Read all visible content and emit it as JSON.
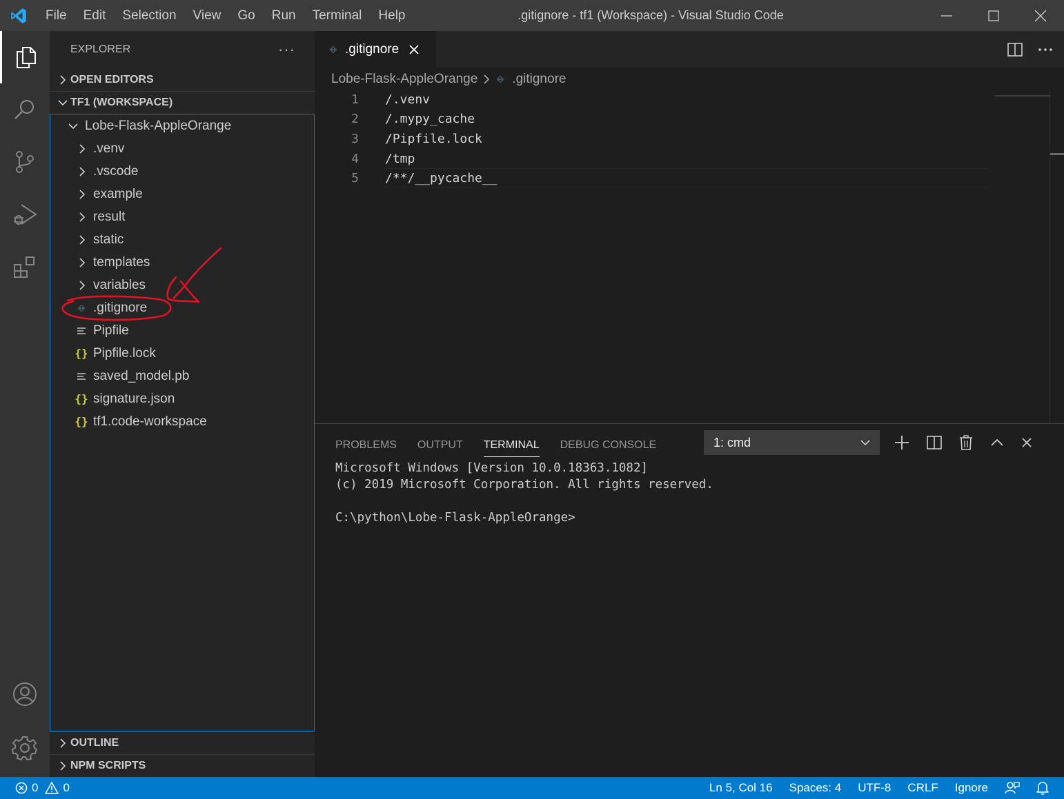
{
  "window": {
    "title": ".gitignore - tf1 (Workspace) - Visual Studio Code",
    "menu": [
      "File",
      "Edit",
      "Selection",
      "View",
      "Go",
      "Run",
      "Terminal",
      "Help"
    ]
  },
  "colors": {
    "titlebar": "#3c3c3c",
    "activitybar": "#333333",
    "sidebar": "#252526",
    "editor": "#1e1e1e",
    "statusbar": "#007acc",
    "focus_border": "#007fd4",
    "annotation": "#e81123",
    "json_icon": "#cbcb41"
  },
  "explorer": {
    "title": "EXPLORER",
    "more_label": "···",
    "open_editors": "OPEN EDITORS",
    "workspace": "TF1 (WORKSPACE)",
    "root_folder": "Lobe-Flask-AppleOrange",
    "folders": [
      ".venv",
      ".vscode",
      "example",
      "result",
      "static",
      "templates",
      "variables"
    ],
    "files": [
      {
        "name": ".gitignore",
        "icon": "git-icon"
      },
      {
        "name": "Pipfile",
        "icon": "lines-icon"
      },
      {
        "name": "Pipfile.lock",
        "icon": "json-icon"
      },
      {
        "name": "saved_model.pb",
        "icon": "lines-icon"
      },
      {
        "name": "signature.json",
        "icon": "json-icon"
      },
      {
        "name": "tf1.code-workspace",
        "icon": "json-icon"
      }
    ],
    "outline": "OUTLINE",
    "npm_scripts": "NPM SCRIPTS"
  },
  "editor": {
    "tab_label": ".gitignore",
    "breadcrumb": [
      "Lobe-Flask-AppleOrange",
      ".gitignore"
    ],
    "lines": [
      {
        "num": "1",
        "text": "/.venv"
      },
      {
        "num": "2",
        "text": "/.mypy_cache"
      },
      {
        "num": "3",
        "text": "/Pipfile.lock"
      },
      {
        "num": "4",
        "text": "/tmp"
      },
      {
        "num": "5",
        "text": "/**/__pycache__"
      }
    ]
  },
  "panel": {
    "tabs": [
      "PROBLEMS",
      "OUTPUT",
      "TERMINAL",
      "DEBUG CONSOLE"
    ],
    "active_tab": "TERMINAL",
    "terminal_select": "1: cmd",
    "terminal_lines": [
      "Microsoft Windows [Version 10.0.18363.1082]",
      "(c) 2019 Microsoft Corporation. All rights reserved.",
      "",
      "C:\\python\\Lobe-Flask-AppleOrange>"
    ]
  },
  "status": {
    "errors": "0",
    "warnings": "0",
    "position": "Ln 5, Col 16",
    "spaces": "Spaces: 4",
    "encoding": "UTF-8",
    "eol": "CRLF",
    "language": "Ignore"
  }
}
